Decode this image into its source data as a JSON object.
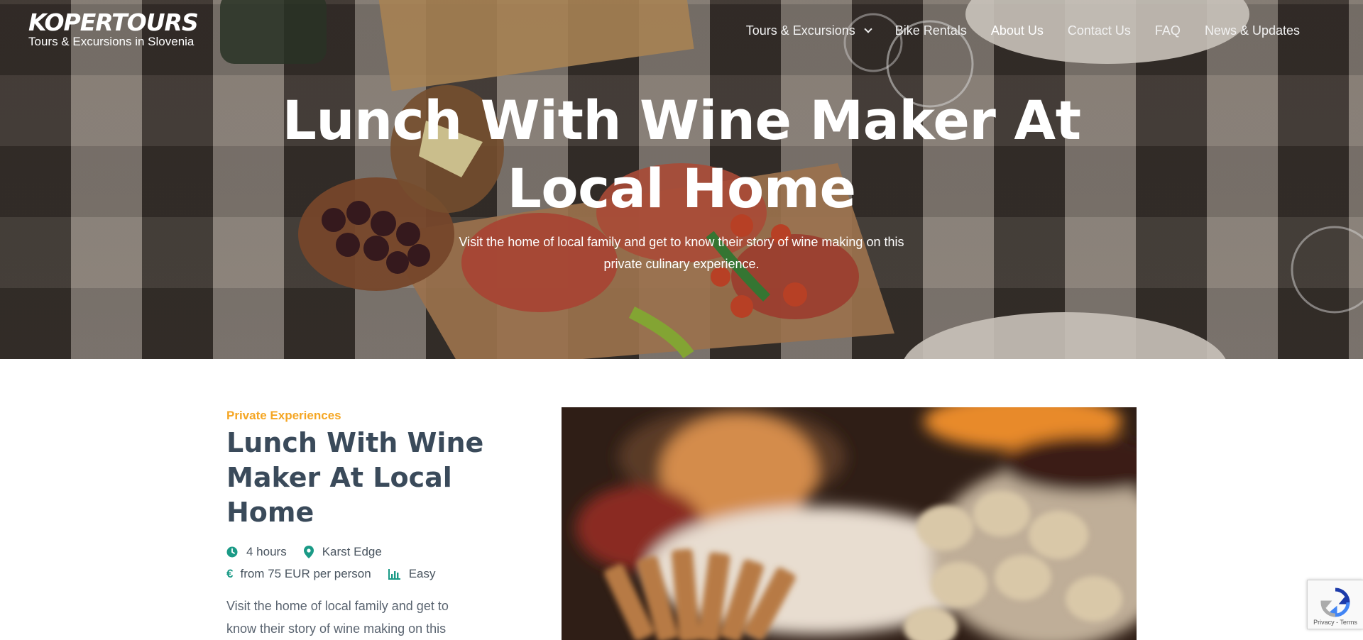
{
  "header": {
    "logo_title": "KOPERTOURS",
    "logo_subtitle": "Tours & Excursions in Slovenia",
    "nav": [
      {
        "label": "Tours & Excursions",
        "has_dropdown": true
      },
      {
        "label": "Bike Rentals"
      },
      {
        "label": "About Us",
        "active": true
      },
      {
        "label": "Contact Us"
      },
      {
        "label": "FAQ"
      },
      {
        "label": "News & Updates"
      }
    ]
  },
  "hero": {
    "title_line1": "Lunch With Wine Maker At",
    "title_line2": "Local Home",
    "subtitle_line1": "Visit the home of local family and get to know their story of wine making on this",
    "subtitle_line2": "private culinary experience."
  },
  "tour": {
    "category": "Private Experiences",
    "title": "Lunch With Wine Maker At Local Home",
    "duration": "4 hours",
    "location": "Karst Edge",
    "price": "from 75 EUR per person",
    "difficulty": "Easy",
    "description_line1": "Visit the home of local family and get to",
    "description_line2": "know their story of wine making on this"
  },
  "recaptcha": {
    "links": "Privacy - Terms"
  },
  "colors": {
    "accent_orange": "#f5a623",
    "accent_teal": "#1a9a86",
    "title_color": "#3a4a5a"
  }
}
